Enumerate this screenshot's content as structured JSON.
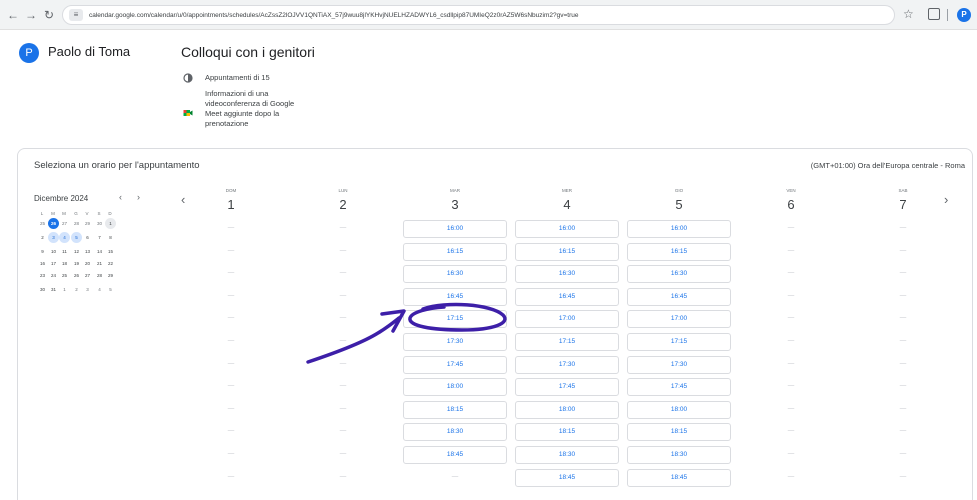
{
  "browser": {
    "url": "calendar.google.com/calendar/u/0/appointments/schedules/AcZssZ2lOJVV1QNTiAX_57j9wuu8jlYKHvjNUELHZADWYL6_csdllpip87UMIeQ2z0rAZ5W6sNbuzim2?gv=true",
    "profile_initial": "P"
  },
  "header": {
    "avatar_initial": "P",
    "owner_name": "Paolo di Toma",
    "title": "Colloqui con i genitori",
    "duration": "Appuntamenti di 15",
    "meet_info": "Informazioni di una videoconferenza di Google Meet aggiunte dopo la prenotazione"
  },
  "panel": {
    "title": "Seleziona un orario per l'appuntamento",
    "timezone": "(GMT+01:00) Ora dell'Europa centrale - Roma"
  },
  "mini_calendar": {
    "month": "Dicembre 2024",
    "prev": "‹",
    "next": "›",
    "weekdays": [
      "L",
      "M",
      "M",
      "G",
      "V",
      "S",
      "D"
    ],
    "weeks": [
      [
        "25",
        "26",
        "27",
        "28",
        "29",
        "30",
        "1"
      ],
      [
        "2",
        "3",
        "4",
        "5",
        "6",
        "7",
        "8"
      ],
      [
        "9",
        "10",
        "11",
        "12",
        "13",
        "14",
        "15"
      ],
      [
        "16",
        "17",
        "18",
        "19",
        "20",
        "21",
        "22"
      ],
      [
        "23",
        "24",
        "25",
        "26",
        "27",
        "28",
        "29"
      ],
      [
        "30",
        "31",
        "1",
        "2",
        "3",
        "4",
        "5"
      ]
    ]
  },
  "week": {
    "prev": "‹",
    "next": "›",
    "days": [
      {
        "abbr": "DOM",
        "num": "1"
      },
      {
        "abbr": "LUN",
        "num": "2"
      },
      {
        "abbr": "MAR",
        "num": "3"
      },
      {
        "abbr": "MER",
        "num": "4"
      },
      {
        "abbr": "GIO",
        "num": "5"
      },
      {
        "abbr": "VEN",
        "num": "6"
      },
      {
        "abbr": "SAB",
        "num": "7"
      }
    ],
    "empty": "—",
    "slots_mar": [
      "16:00",
      "16:15",
      "16:30",
      "16:45",
      "17:15",
      "17:30",
      "17:45",
      "18:00",
      "18:15",
      "18:30",
      "18:45"
    ],
    "slots_mer": [
      "16:00",
      "16:15",
      "16:30",
      "16:45",
      "17:00",
      "17:15",
      "17:30",
      "17:45",
      "18:00",
      "18:15",
      "18:30",
      "18:45"
    ],
    "slots_gio": [
      "16:00",
      "16:15",
      "16:30",
      "16:45",
      "17:00",
      "17:15",
      "17:30",
      "17:45",
      "18:00",
      "18:15",
      "18:30",
      "18:45"
    ]
  },
  "colors": {
    "accent": "#1a73e8",
    "annotation": "#3d1fa8"
  }
}
